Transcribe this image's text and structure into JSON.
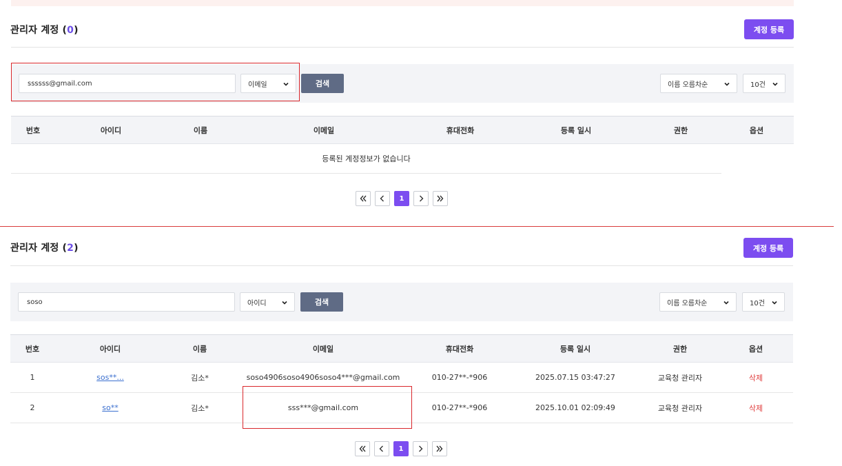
{
  "colors": {
    "accent": "#7c4df0",
    "search_button": "#5f6b85",
    "danger": "#e03c3c",
    "link": "#3a6fcf",
    "annotation_red": "#d9262a"
  },
  "top": {
    "title_prefix": "관리자 계정 (",
    "count": "0",
    "title_suffix": ")",
    "register_label": "계정 등록",
    "search_value": "ssssss@gmail.com",
    "filter_selected": "이메일",
    "search_label": "검색",
    "sort_selected": "이름 오름차순",
    "page_size_selected": "10건",
    "columns": [
      "번호",
      "아이디",
      "이름",
      "이메일",
      "휴대전화",
      "등록 일시",
      "권한",
      "옵션"
    ],
    "empty_message": "등록된 계정정보가 없습니다",
    "pagination": {
      "current": "1"
    }
  },
  "bottom": {
    "title_prefix": "관리자 계정 (",
    "count": "2",
    "title_suffix": ")",
    "register_label": "계정 등록",
    "search_value": "soso",
    "filter_selected": "아이디",
    "search_label": "검색",
    "sort_selected": "이름 오름차순",
    "page_size_selected": "10건",
    "columns": [
      "번호",
      "아이디",
      "이름",
      "이메일",
      "휴대전화",
      "등록 일시",
      "권한",
      "옵션"
    ],
    "rows": [
      {
        "no": "1",
        "id": "sos**...",
        "name": "김소*",
        "email": "soso4906soso4906soso4***@gmail.com",
        "phone": "010-27**-*906",
        "registered": "2025.07.15 03:47:27",
        "role": "교육청 관리자",
        "option": "삭제"
      },
      {
        "no": "2",
        "id": "so**",
        "name": "김소*",
        "email": "sss***@gmail.com",
        "phone": "010-27**-*906",
        "registered": "2025.10.01 02:09:49",
        "role": "교육청 관리자",
        "option": "삭제"
      }
    ],
    "pagination": {
      "current": "1"
    }
  }
}
